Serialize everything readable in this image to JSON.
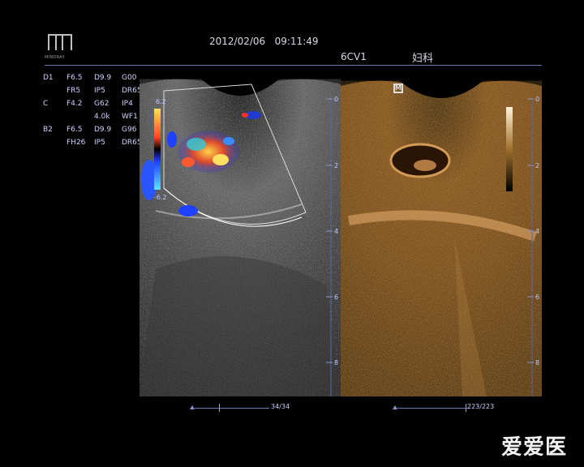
{
  "header": {
    "brand": "MINDRAY",
    "datetime": "2012/02/06   09:11:49",
    "probe": "6CV1",
    "exam": "妇科"
  },
  "params": [
    {
      "c0": "D1",
      "c1": "F6.5",
      "c2": "D9.9",
      "c3": "G00"
    },
    {
      "c0": "",
      "c1": "FR5",
      "c2": "IP5",
      "c3": "DR65"
    },
    {
      "c0": "C",
      "c1": "F4.2",
      "c2": "G62",
      "c3": "IP4"
    },
    {
      "c0": "",
      "c1": "",
      "c2": "4.0k",
      "c3": "WF1"
    },
    {
      "c0": "B2",
      "c1": "F6.5",
      "c2": "D9.9",
      "c3": "G96"
    },
    {
      "c0": "",
      "c1": "FH26",
      "c2": "IP5",
      "c3": "DR65"
    }
  ],
  "left_image": {
    "color_scale_top": "6.2",
    "color_scale_bottom": "-6.2",
    "depth_labels": [
      "0",
      "2",
      "4",
      "6",
      "8"
    ]
  },
  "right_image": {
    "marker": "M",
    "depth_labels": [
      "0",
      "2",
      "4",
      "6",
      "8"
    ]
  },
  "cine": {
    "left_frame": "34/34",
    "right_frame": "223/223"
  },
  "watermark": "爱爱医",
  "colors": {
    "panel_line": "#6a79a8",
    "param_text": "#cfd3ff",
    "gray_tissue": "#5a5a5a",
    "sepia_tissue": "#8a5a2a"
  }
}
